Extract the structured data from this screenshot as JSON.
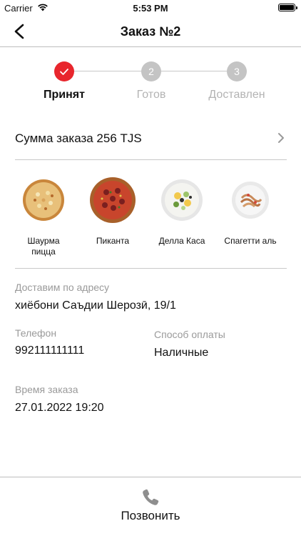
{
  "status_bar": {
    "carrier": "Carrier",
    "time": "5:53 PM"
  },
  "nav": {
    "title": "Заказ №2"
  },
  "progress": {
    "steps": [
      {
        "number": "✓",
        "label": "Принят",
        "state": "done"
      },
      {
        "number": "2",
        "label": "Готов",
        "state": "pending"
      },
      {
        "number": "3",
        "label": "Доставлен",
        "state": "pending"
      }
    ]
  },
  "order": {
    "sum_text": "Сумма заказа 256 TJS"
  },
  "items": [
    {
      "name": "Шаурма пицца",
      "icon": "pizza-image"
    },
    {
      "name": "Пиканта",
      "icon": "pizza-image"
    },
    {
      "name": "Делла Каса",
      "icon": "salad-image"
    },
    {
      "name": "Спагетти аль",
      "icon": "pasta-image"
    }
  ],
  "delivery": {
    "label": "Доставим по адресу",
    "address": "хиёбони Саъдии Шерозӣ, 19/1"
  },
  "phone": {
    "label": "Телефон",
    "value": "992111111111"
  },
  "payment": {
    "label": "Способ оплаты",
    "value": "Наличные"
  },
  "order_time": {
    "label": "Время заказа",
    "value": "27.01.2022 19:20"
  },
  "bottom": {
    "call_label": "Позвонить"
  },
  "colors": {
    "accent": "#e8262d",
    "inactive": "#c4c4c4",
    "muted_text": "#9a9a9a"
  }
}
